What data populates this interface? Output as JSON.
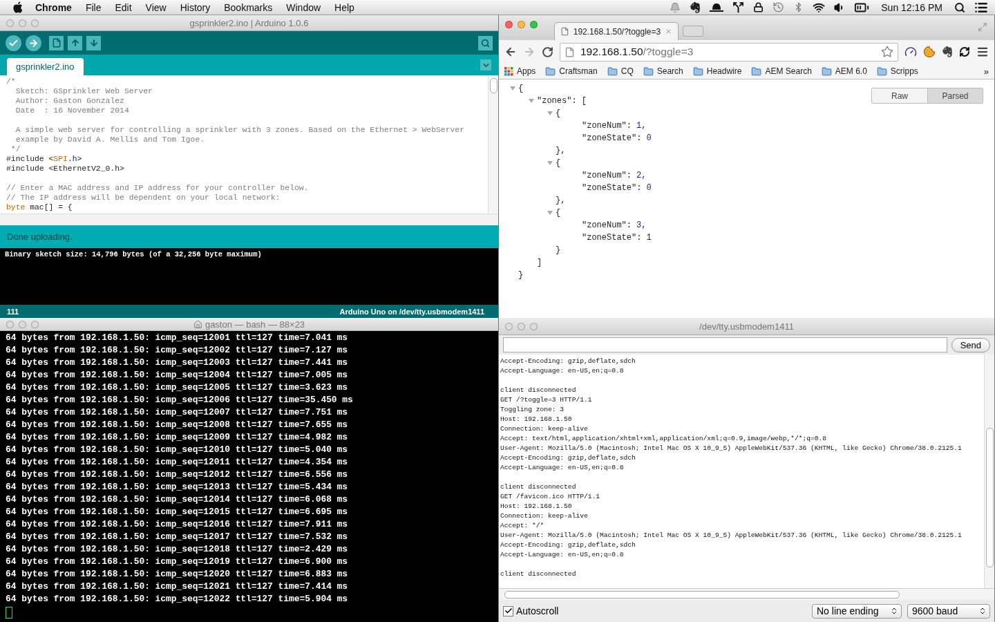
{
  "menu_bar": {
    "items": [
      {
        "label": "Chrome",
        "kind": "app"
      },
      {
        "label": "File",
        "kind": "menu"
      },
      {
        "label": "Edit",
        "kind": "menu"
      },
      {
        "label": "View",
        "kind": "menu"
      },
      {
        "label": "History",
        "kind": "menu"
      },
      {
        "label": "Bookmarks",
        "kind": "menu"
      },
      {
        "label": "Window",
        "kind": "menu"
      },
      {
        "label": "Help",
        "kind": "menu"
      }
    ],
    "clock": "Sun 12:16 PM"
  },
  "arduino": {
    "active": false,
    "title": "gsprinkler2.ino | Arduino 1.0.6",
    "tab": "gsprinkler2.ino",
    "code": [
      [
        [
          {
            "text": "/*",
            "kind": "comment"
          }
        ],
        [
          {
            "text": "  Sketch: GSprinkler Web Server",
            "kind": "comment"
          }
        ],
        [
          {
            "text": "  Author: Gaston Gonzalez",
            "kind": "comment"
          }
        ],
        [
          {
            "text": "  Date  : 16 November 2014",
            "kind": "comment"
          }
        ]
      ],
      [
        [
          {
            "text": "  A simple web server for controlling a sprinkler with 3 zones. Based on the Ethernet > WebServer",
            "kind": "comment"
          }
        ],
        [
          {
            "text": "  example by David A. Mellis and Tom Igoe.",
            "kind": "comment"
          }
        ],
        [
          {
            "text": " */",
            "kind": "comment"
          }
        ],
        [
          {
            "text": "#include <",
            "kind": "plain"
          },
          {
            "text": "SPI",
            "kind": "keyword"
          },
          {
            "text": ".h>",
            "kind": "plain"
          }
        ],
        [
          {
            "text": "#include <EthernetV2_0.h>",
            "kind": "plain"
          }
        ]
      ],
      [
        [
          {
            "text": "// Enter a MAC address and IP address for your controller below.",
            "kind": "comment"
          }
        ],
        [
          {
            "text": "// The IP address will be dependent on your local network:",
            "kind": "comment"
          }
        ],
        [
          {
            "text": "byte",
            "kind": "keyword"
          },
          {
            "text": " mac[] = {",
            "kind": "plain"
          }
        ]
      ]
    ],
    "status": "Done uploading.",
    "console": [
      "Binary sketch size: 14,796 bytes (of a 32,256 byte maximum)"
    ],
    "line_number": "111",
    "board": "Arduino Uno on /dev/tty.usbmodem1411"
  },
  "chrome": {
    "active": true,
    "tab_title": "192.168.1.50/?toggle=3",
    "nav": [
      {
        "kind": "back",
        "disabled": false
      },
      {
        "kind": "forward",
        "disabled": true
      },
      {
        "kind": "reload",
        "disabled": false
      }
    ],
    "url_host": "192.168.1.50",
    "url_path": "/?toggle=3",
    "bookmarks": [
      {
        "label": "Apps",
        "kind": "apps"
      },
      {
        "label": "Craftsman",
        "kind": "folder"
      },
      {
        "label": "CQ",
        "kind": "folder"
      },
      {
        "label": "Search",
        "kind": "folder"
      },
      {
        "label": "Headwire",
        "kind": "folder"
      },
      {
        "label": "AEM Search",
        "kind": "folder"
      },
      {
        "label": "AEM 6.0",
        "kind": "folder"
      },
      {
        "label": "Scripps",
        "kind": "folder"
      }
    ],
    "bookmarks_more": "»",
    "viewer": {
      "modes": [
        {
          "label": "Raw",
          "selected": false
        },
        {
          "label": "Parsed",
          "selected": true
        }
      ],
      "tree": {
        "text": "{",
        "expanded": true,
        "close": "}",
        "children": [
          {
            "text": "\"zones\": [",
            "expanded": true,
            "close": "]",
            "children": [
              {
                "text": "{",
                "expanded": true,
                "close": "},",
                "children": [
                  {
                    "key": "\"zoneNum\":",
                    "value": "1",
                    "trail": ","
                  },
                  {
                    "key": "\"zoneState\":",
                    "value": "0"
                  }
                ]
              },
              {
                "text": "{",
                "expanded": true,
                "close": "},",
                "children": [
                  {
                    "key": "\"zoneNum\":",
                    "value": "2",
                    "trail": ","
                  },
                  {
                    "key": "\"zoneState\":",
                    "value": "0"
                  }
                ]
              },
              {
                "text": "{",
                "expanded": true,
                "close": "}",
                "children": [
                  {
                    "key": "\"zoneNum\":",
                    "value": "3",
                    "trail": ","
                  },
                  {
                    "key": "\"zoneState\":",
                    "value": "1"
                  }
                ]
              }
            ]
          }
        ]
      }
    }
  },
  "terminal": {
    "active": false,
    "title": "gaston — bash — 88×23",
    "lines": [
      "64 bytes from 192.168.1.50: icmp_seq=12001 ttl=127 time=7.041 ms",
      "64 bytes from 192.168.1.50: icmp_seq=12002 ttl=127 time=7.127 ms",
      "64 bytes from 192.168.1.50: icmp_seq=12003 ttl=127 time=7.441 ms",
      "64 bytes from 192.168.1.50: icmp_seq=12004 ttl=127 time=7.005 ms",
      "64 bytes from 192.168.1.50: icmp_seq=12005 ttl=127 time=3.623 ms",
      "64 bytes from 192.168.1.50: icmp_seq=12006 ttl=127 time=35.450 ms",
      "64 bytes from 192.168.1.50: icmp_seq=12007 ttl=127 time=7.751 ms",
      "64 bytes from 192.168.1.50: icmp_seq=12008 ttl=127 time=7.655 ms",
      "64 bytes from 192.168.1.50: icmp_seq=12009 ttl=127 time=4.982 ms",
      "64 bytes from 192.168.1.50: icmp_seq=12010 ttl=127 time=5.040 ms",
      "64 bytes from 192.168.1.50: icmp_seq=12011 ttl=127 time=4.354 ms",
      "64 bytes from 192.168.1.50: icmp_seq=12012 ttl=127 time=6.556 ms",
      "64 bytes from 192.168.1.50: icmp_seq=12013 ttl=127 time=5.434 ms",
      "64 bytes from 192.168.1.50: icmp_seq=12014 ttl=127 time=6.068 ms",
      "64 bytes from 192.168.1.50: icmp_seq=12015 ttl=127 time=6.695 ms",
      "64 bytes from 192.168.1.50: icmp_seq=12016 ttl=127 time=7.911 ms",
      "64 bytes from 192.168.1.50: icmp_seq=12017 ttl=127 time=7.532 ms",
      "64 bytes from 192.168.1.50: icmp_seq=12018 ttl=127 time=2.429 ms",
      "64 bytes from 192.168.1.50: icmp_seq=12019 ttl=127 time=6.900 ms",
      "64 bytes from 192.168.1.50: icmp_seq=12020 ttl=127 time=6.883 ms",
      "64 bytes from 192.168.1.50: icmp_seq=12021 ttl=127 time=7.414 ms",
      "64 bytes from 192.168.1.50: icmp_seq=12022 ttl=127 time=5.904 ms"
    ]
  },
  "serial_monitor": {
    "active": false,
    "title": "/dev/tty.usbmodem1411",
    "send": "Send",
    "blocks": [
      [
        "Accept-Encoding: gzip,deflate,sdch",
        "Accept-Language: en-US,en;q=0.8"
      ],
      [
        "client disconnected",
        "GET /?toggle=3 HTTP/1.1",
        "Toggling zone: 3",
        "Host: 192.168.1.50",
        "Connection: keep-alive",
        "Accept: text/html,application/xhtml+xml,application/xml;q=0.9,image/webp,*/*;q=0.8",
        "User-Agent: Mozilla/5.0 (Macintosh; Intel Mac OS X 10_9_5) AppleWebKit/537.36 (KHTML, like Gecko) Chrome/38.0.2125.1",
        "Accept-Encoding: gzip,deflate,sdch",
        "Accept-Language: en-US,en;q=0.8"
      ],
      [
        "client disconnected",
        "GET /favicon.ico HTTP/1.1",
        "Host: 192.168.1.50",
        "Connection: keep-alive",
        "Accept: */*",
        "User-Agent: Mozilla/5.0 (Macintosh; Intel Mac OS X 10_9_5) AppleWebKit/537.36 (KHTML, like Gecko) Chrome/38.0.2125.1",
        "Accept-Encoding: gzip,deflate,sdch",
        "Accept-Language: en-US,en;q=0.8"
      ],
      [
        "client disconnected"
      ]
    ],
    "autoscroll": {
      "label": "Autoscroll",
      "checked": true
    },
    "line_ending": "No line ending",
    "baud": "9600 baud"
  }
}
